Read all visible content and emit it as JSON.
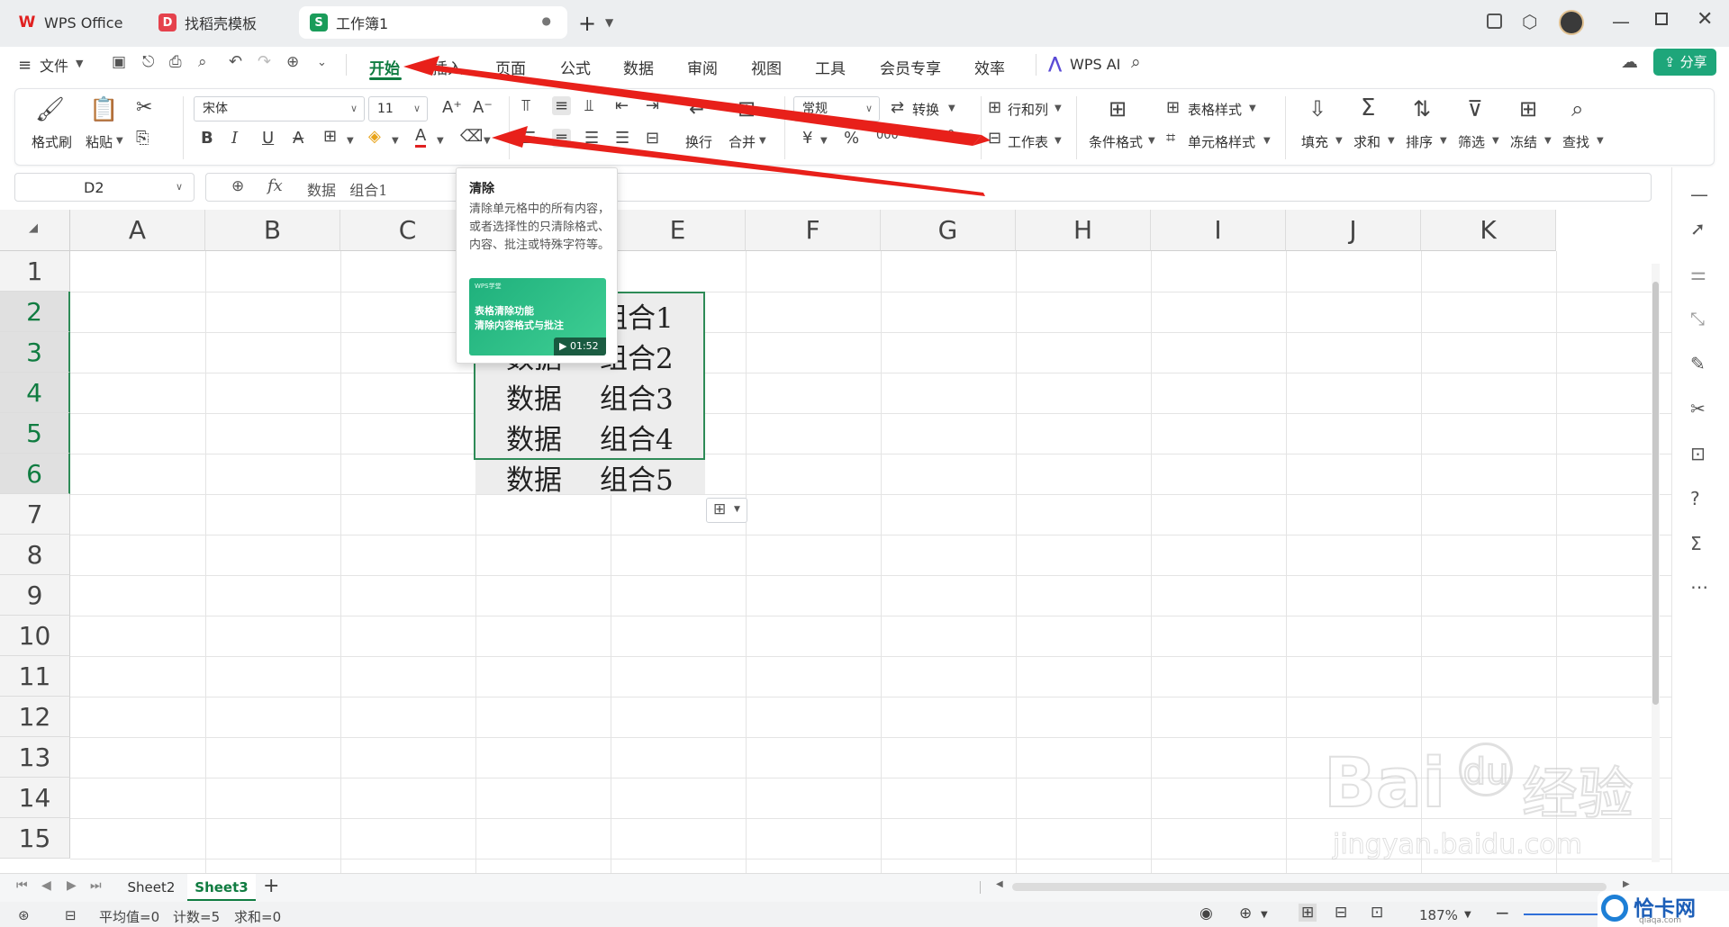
{
  "tabs": [
    {
      "label": "WPS Office",
      "icon": "wps-logo-icon"
    },
    {
      "label": "找稻壳模板",
      "icon": "docer-icon"
    },
    {
      "label": "工作簿1",
      "icon": "spreadsheet-icon"
    }
  ],
  "menu": {
    "file": "文件",
    "items": [
      "开始",
      "插入",
      "页面",
      "公式",
      "数据",
      "审阅",
      "视图",
      "工具",
      "会员专享",
      "效率"
    ],
    "active": "开始",
    "wps_ai": "WPS AI",
    "share": "分享"
  },
  "ribbon": {
    "format_painter": "格式刷",
    "paste": "粘贴",
    "font_name": "宋体",
    "font_size": "11",
    "wrap": "换行",
    "merge": "合并",
    "number_format": "常规",
    "convert": "转换",
    "row_col": "行和列",
    "sheet": "工作表",
    "cond_format": "条件格式",
    "table_style": "表格样式",
    "cell_style": "单元格样式",
    "fill": "填充",
    "sum": "求和",
    "sort": "排序",
    "filter": "筛选",
    "freeze": "冻结",
    "find": "查找"
  },
  "formula_bar": {
    "name_box": "D2",
    "fx": "fx",
    "content": "数据   组合1"
  },
  "columns": [
    "A",
    "B",
    "C",
    "D",
    "E",
    "F",
    "G",
    "H",
    "I",
    "J",
    "K"
  ],
  "rows": [
    "1",
    "2",
    "3",
    "4",
    "5",
    "6",
    "7",
    "8",
    "9",
    "10",
    "11",
    "12",
    "13",
    "14",
    "15"
  ],
  "cells": [
    {
      "a": "数据",
      "b": "组合1"
    },
    {
      "a": "数据",
      "b": "组合2"
    },
    {
      "a": "数据",
      "b": "组合3"
    },
    {
      "a": "数据",
      "b": "组合4"
    },
    {
      "a": "数据",
      "b": "组合5"
    }
  ],
  "tooltip": {
    "title": "清除",
    "desc": "清除单元格中的所有内容，或者选择性的只清除格式、内容、批注或特殊字符等。",
    "video_brand": "WPS学堂",
    "video_title1": "表格清除功能",
    "video_title2": "清除内容格式与批注",
    "duration": "01:52"
  },
  "sheets": [
    "Sheet2",
    "Sheet3"
  ],
  "active_sheet": "Sheet3",
  "status": {
    "average": "平均值=0",
    "count": "计数=5",
    "sum": "求和=0",
    "zoom": "187%"
  },
  "watermark": {
    "baidu": "Bai",
    "du": "du",
    "jingyan": "经验",
    "url": "jingyan.baidu.com",
    "corner": "恰卡网",
    "corner_url": "qiaqa.com"
  },
  "colors": {
    "accent": "#107c41",
    "share_bg": "#1ea67a",
    "arrow": "#e8201a",
    "selection": "#2e8b57"
  }
}
